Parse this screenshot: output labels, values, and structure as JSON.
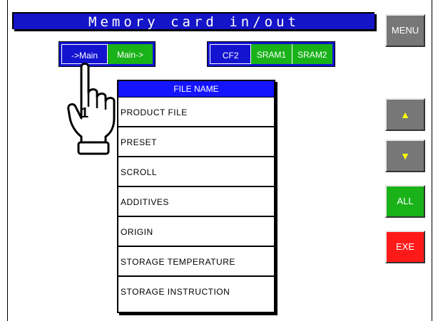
{
  "header": {
    "title": "Memory card in/out"
  },
  "transfer": {
    "to_main_label": "->Main",
    "from_main_label": "Main->"
  },
  "memory": {
    "cf2_label": "CF2",
    "sram1_label": "SRAM1",
    "sram2_label": "SRAM2"
  },
  "side": {
    "menu_label": "MENU",
    "up_label": "▲",
    "down_label": "▼",
    "all_label": "ALL",
    "exe_label": "EXE"
  },
  "file_list": {
    "header": "FILE NAME",
    "items": [
      "PRODUCT FILE",
      "PRESET",
      "SCROLL",
      "ADDITIVES",
      "ORIGIN",
      "STORAGE TEMPERATURE",
      "STORAGE INSTRUCTION"
    ]
  },
  "annotation": {
    "step_number": "1"
  },
  "colors": {
    "blue": "#1414d0",
    "green": "#19b219",
    "red": "#ff1a1a",
    "gray": "#777777"
  }
}
